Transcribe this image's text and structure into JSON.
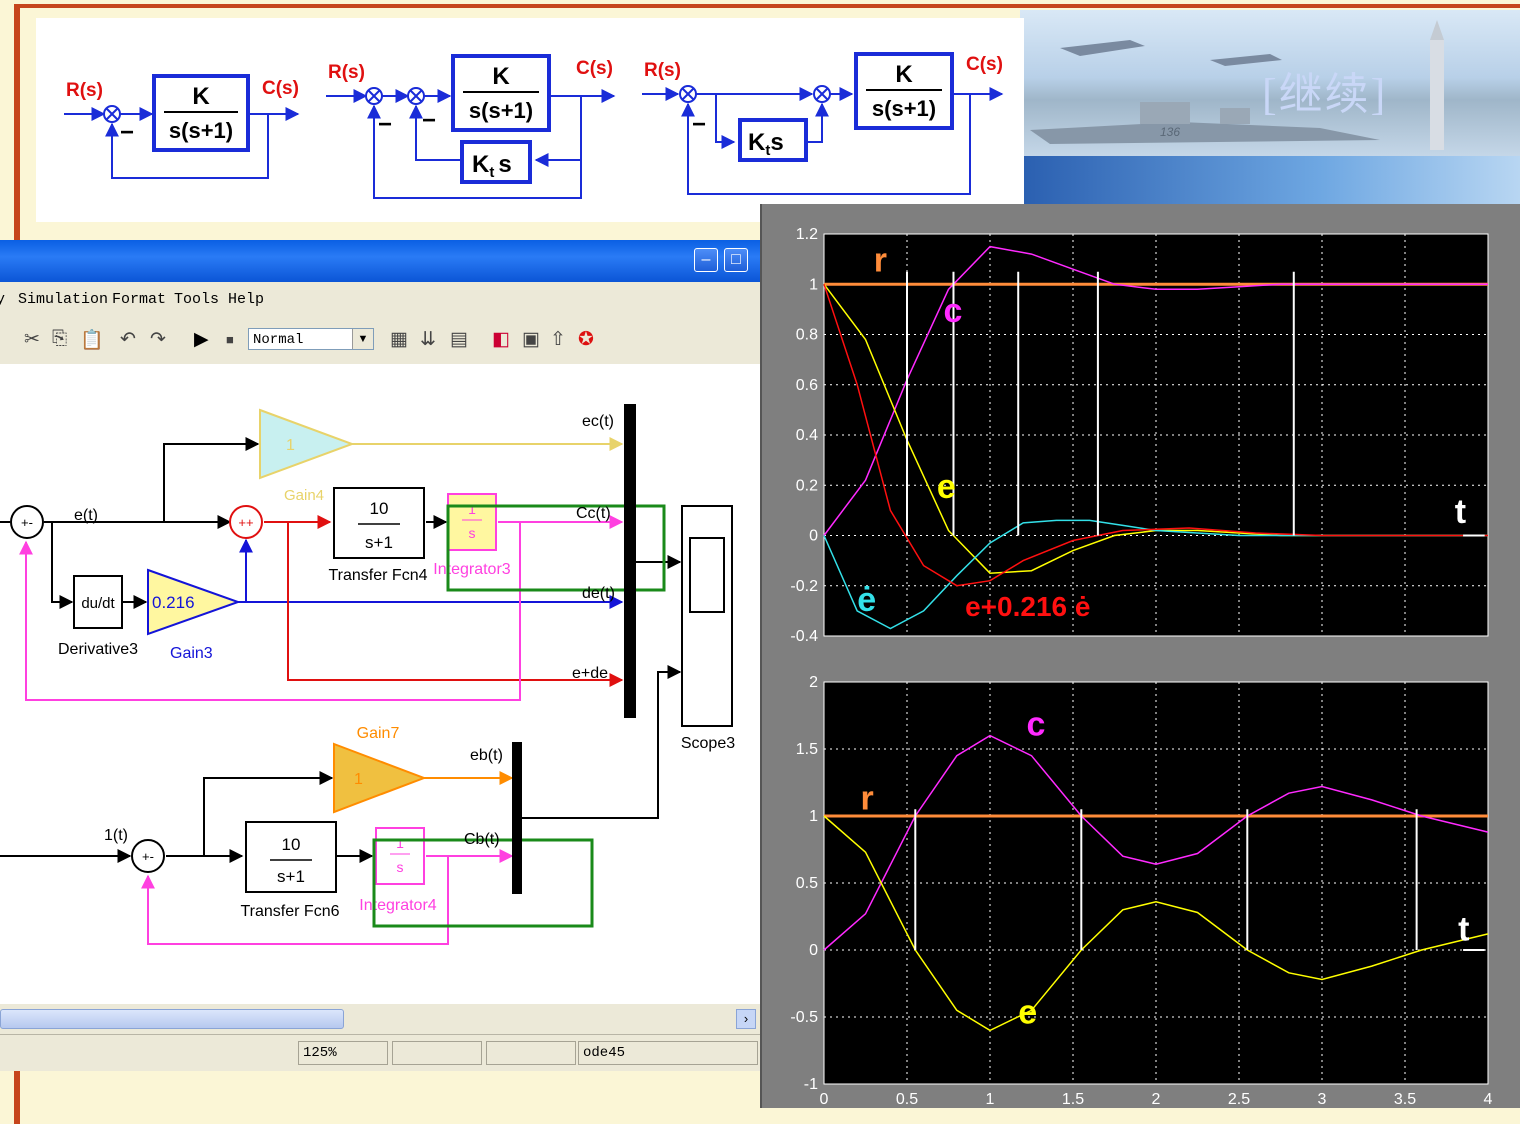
{
  "banner": {
    "continue_label": "[继续]",
    "ship_number": "136"
  },
  "block_diagrams": {
    "input_label": "R(s)",
    "output_label": "C(s)",
    "tf_numerator": "K",
    "tf_denominator": "s(s+1)",
    "feedback_sign": "−",
    "rate_gain_prefix": "K",
    "rate_gain_subscript": "t",
    "rate_gain_suffix": "s"
  },
  "simulink": {
    "menu": [
      "Simulation",
      "Format",
      "Tools",
      "Help"
    ],
    "mode": "Normal",
    "status": {
      "zoom": "125%",
      "solver": "ode45"
    },
    "blocks": {
      "gain4_value": "1",
      "gain4_name": "Gain4",
      "gain3_value": "0.216",
      "gain3_name": "Gain3",
      "derivative_text": "du/dt",
      "derivative_name": "Derivative3",
      "tf4_num": "10",
      "tf4_den": "s+1",
      "tf4_name": "Transfer Fcn4",
      "int3_num": "1",
      "int3_den": "s",
      "int3_name": "Integrator3",
      "gain7_value": "1",
      "gain7_name": "Gain7",
      "tf6_num": "10",
      "tf6_den": "s+1",
      "tf6_name": "Transfer Fcn6",
      "int4_num": "1",
      "int4_den": "s",
      "int4_name": "Integrator4",
      "scope_name": "Scope3"
    },
    "signals": {
      "e": "e(t)",
      "ec": "ec(t)",
      "cc": "Cc(t)",
      "de": "de(t)",
      "ede": "e+de",
      "eb": "eb(t)",
      "cb": "Cb(t)",
      "step": "1(t)"
    }
  },
  "chart_data": [
    {
      "type": "line",
      "title": "",
      "xlim": [
        0,
        4
      ],
      "ylim": [
        -0.4,
        1.2
      ],
      "yticks": [
        "1.2",
        "1",
        "0.8",
        "0.6",
        "0.4",
        "0.2",
        "0",
        "-0.2",
        "-0.4"
      ],
      "grid": true,
      "background": "#000000",
      "annotations": {
        "r": "r",
        "c": "c",
        "e": "e",
        "edot": "ė",
        "combo": "e+0.216 ė",
        "t": "t"
      },
      "series": [
        {
          "name": "r",
          "color": "#ff8c3a",
          "x": [
            0,
            4
          ],
          "y": [
            1,
            1
          ]
        },
        {
          "name": "c",
          "color": "#ff2aff",
          "x": [
            0,
            0.25,
            0.5,
            0.75,
            1.0,
            1.25,
            1.5,
            1.75,
            2.0,
            2.25,
            2.5,
            2.75,
            3.0,
            3.5,
            4.0
          ],
          "y": [
            0,
            0.22,
            0.62,
            0.98,
            1.15,
            1.12,
            1.06,
            1.0,
            0.98,
            0.98,
            0.99,
            1.0,
            1.0,
            1.0,
            1.0
          ]
        },
        {
          "name": "e",
          "color": "#ffff00",
          "x": [
            0,
            0.25,
            0.5,
            0.75,
            1.0,
            1.25,
            1.5,
            1.75,
            2.0,
            2.25,
            2.5,
            2.75,
            3.0,
            3.5,
            4.0
          ],
          "y": [
            1,
            0.78,
            0.38,
            0.02,
            -0.15,
            -0.14,
            -0.06,
            0.0,
            0.02,
            0.02,
            0.01,
            0.0,
            0.0,
            0.0,
            0.0
          ]
        },
        {
          "name": "ė",
          "color": "#33e0e8",
          "x": [
            0,
            0.2,
            0.4,
            0.6,
            0.8,
            1.0,
            1.2,
            1.4,
            1.6,
            1.8,
            2.0,
            2.5,
            3.0,
            4.0
          ],
          "y": [
            0,
            -0.3,
            -0.37,
            -0.3,
            -0.16,
            -0.03,
            0.05,
            0.06,
            0.06,
            0.04,
            0.02,
            0.0,
            0.0,
            0.0
          ]
        },
        {
          "name": "e+0.216 ė",
          "color": "#ff1010",
          "x": [
            0,
            0.2,
            0.4,
            0.6,
            0.8,
            1.0,
            1.2,
            1.5,
            1.8,
            2.2,
            2.6,
            3.0,
            4.0
          ],
          "y": [
            1,
            0.6,
            0.1,
            -0.12,
            -0.2,
            -0.18,
            -0.1,
            -0.02,
            0.02,
            0.03,
            0.01,
            0.0,
            0.0
          ]
        }
      ],
      "markers_x": [
        0.5,
        0.78,
        1.17,
        1.65,
        2.83
      ]
    },
    {
      "type": "line",
      "title": "",
      "xlim": [
        0,
        4
      ],
      "ylim": [
        -1,
        2
      ],
      "xticks": [
        "0",
        "0.5",
        "1",
        "1.5",
        "2",
        "2.5",
        "3",
        "3.5",
        "4"
      ],
      "yticks": [
        "2",
        "1.5",
        "1",
        "0.5",
        "0",
        "-0.5",
        "-1"
      ],
      "grid": true,
      "background": "#000000",
      "annotations": {
        "r": "r",
        "c": "c",
        "e": "e",
        "t": "t"
      },
      "series": [
        {
          "name": "r",
          "color": "#ff8c3a",
          "x": [
            0,
            4
          ],
          "y": [
            1,
            1
          ]
        },
        {
          "name": "c",
          "color": "#ff2aff",
          "x": [
            0,
            0.25,
            0.55,
            0.8,
            1.0,
            1.25,
            1.55,
            1.8,
            2.0,
            2.25,
            2.55,
            2.8,
            3.0,
            3.3,
            3.6,
            4.0
          ],
          "y": [
            0,
            0.27,
            1.0,
            1.45,
            1.6,
            1.45,
            1.0,
            0.7,
            0.64,
            0.72,
            1.0,
            1.17,
            1.22,
            1.12,
            1.0,
            0.88
          ]
        },
        {
          "name": "e",
          "color": "#ffff00",
          "x": [
            0,
            0.25,
            0.55,
            0.8,
            1.0,
            1.25,
            1.55,
            1.8,
            2.0,
            2.25,
            2.55,
            2.8,
            3.0,
            3.3,
            3.6,
            4.0
          ],
          "y": [
            1,
            0.73,
            0.0,
            -0.45,
            -0.6,
            -0.45,
            0.0,
            0.3,
            0.36,
            0.28,
            0.0,
            -0.17,
            -0.22,
            -0.12,
            0.0,
            0.12
          ]
        }
      ],
      "markers_x": [
        0.55,
        1.55,
        2.55,
        3.57
      ]
    }
  ]
}
